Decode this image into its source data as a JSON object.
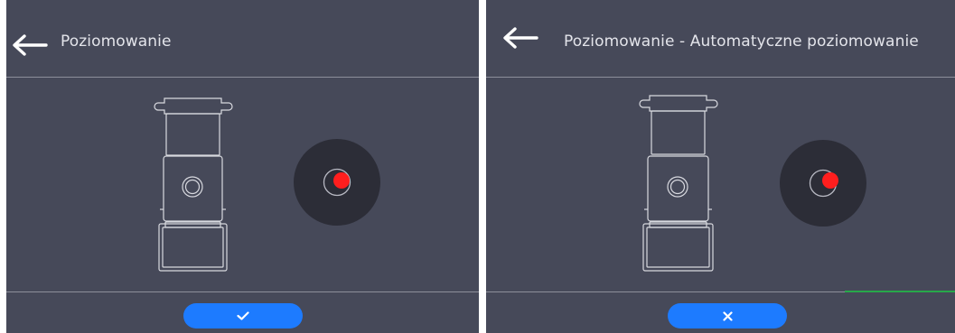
{
  "screens": [
    {
      "title": "Poziomowanie",
      "back_icon": "arrow-left-icon",
      "footer_button_icon": "check-icon",
      "level_indicator_state": "off-center"
    },
    {
      "title": "Poziomowanie - Automatyczne poziomowanie",
      "back_icon": "arrow-left-icon",
      "footer_button_icon": "close-icon",
      "level_indicator_state": "near-center"
    }
  ],
  "colors": {
    "panel_bg": "#464959",
    "dial_bg": "#2c2d37",
    "bubble": "#ff1e1e",
    "button_accent": "#1d7bff",
    "outline": "#d8d9df",
    "progress": "#27a84a"
  }
}
